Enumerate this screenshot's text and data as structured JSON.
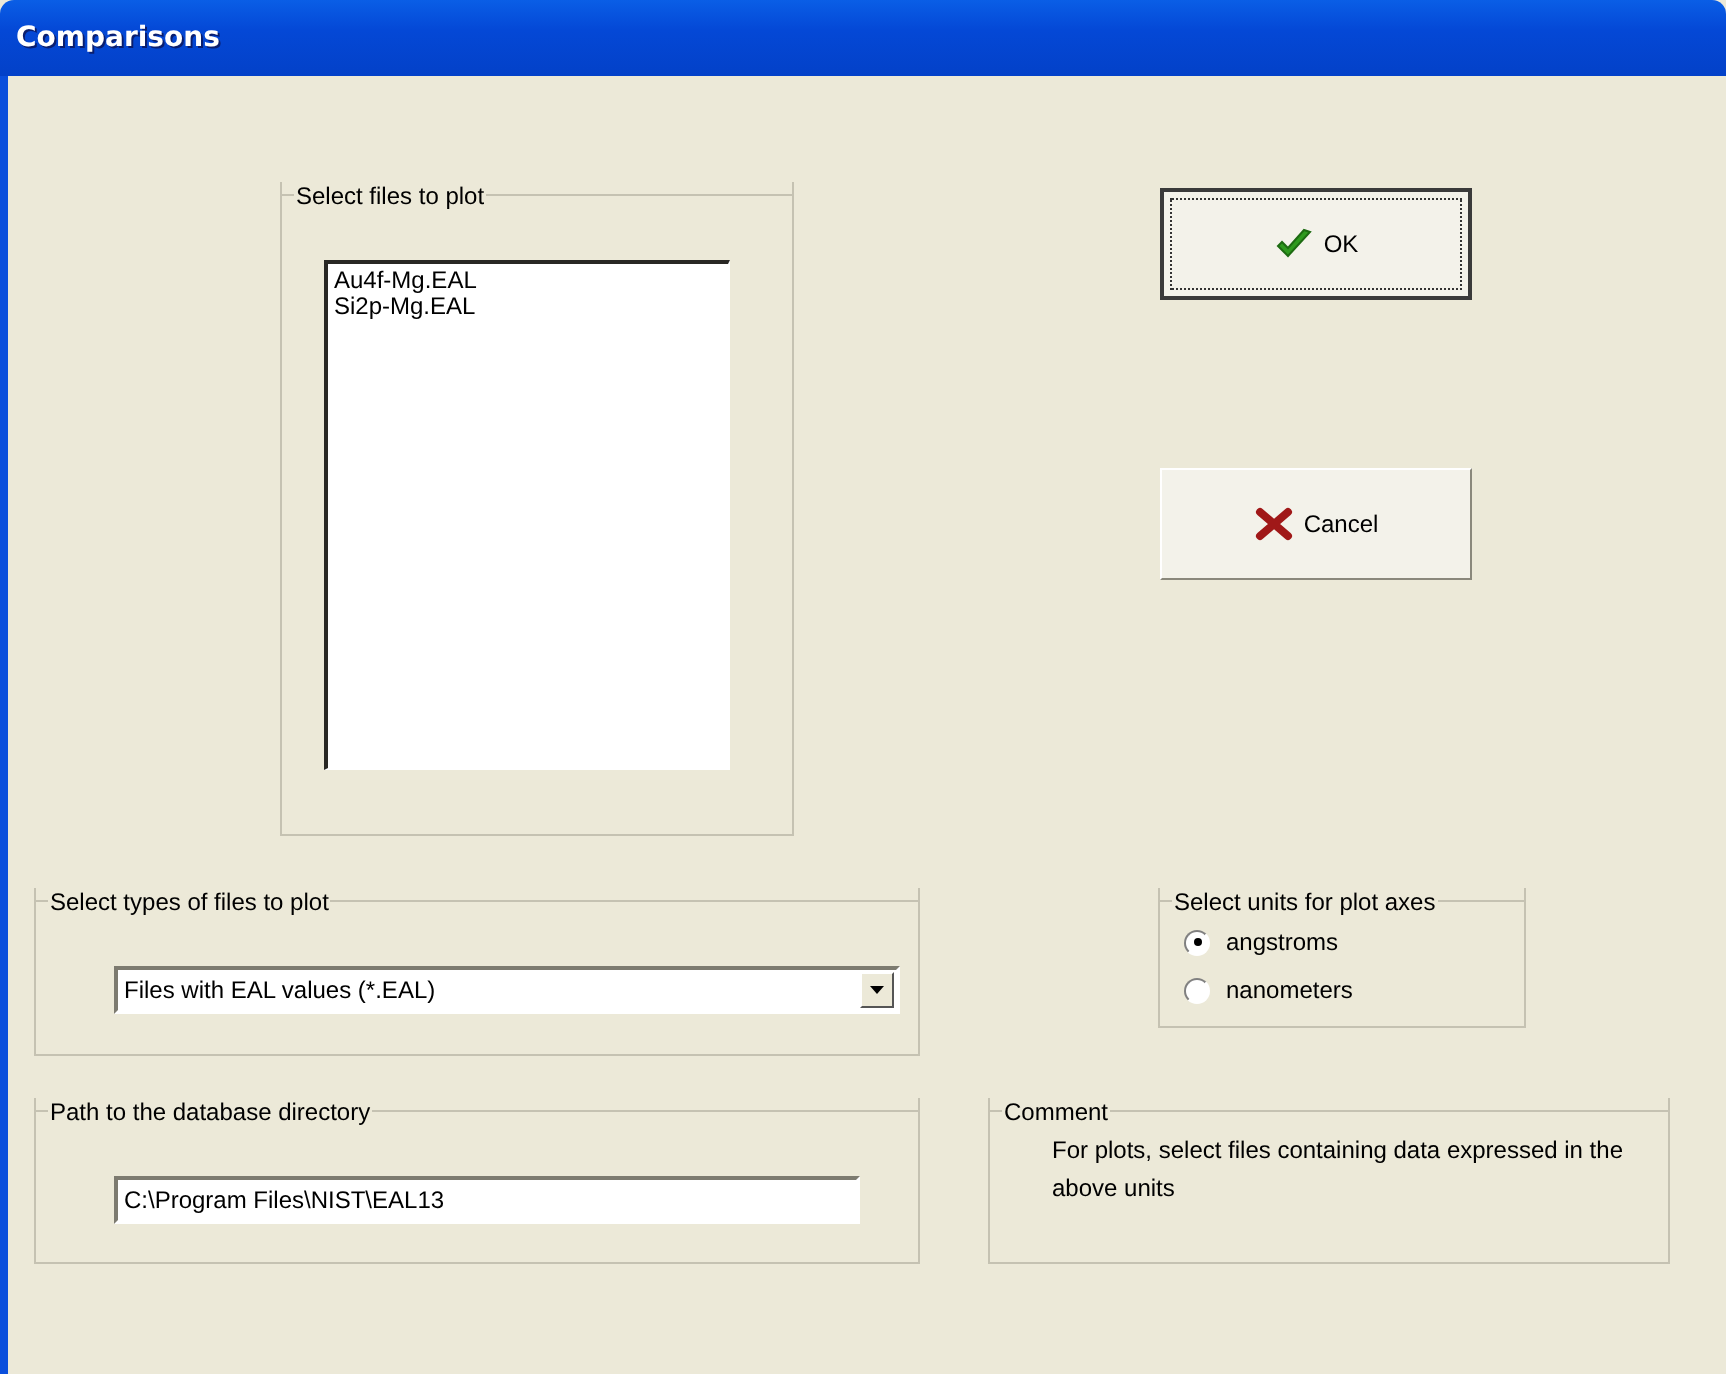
{
  "window": {
    "title": "Comparisons"
  },
  "file_list": {
    "label": "Select files to plot",
    "items": [
      "Au4f-Mg.EAL",
      "Si2p-Mg.EAL"
    ]
  },
  "buttons": [
    {
      "kind": "ok",
      "label": "OK",
      "focused": true
    },
    {
      "kind": "cancel",
      "label": "Cancel",
      "focused": false
    }
  ],
  "file_types": {
    "label": "Select types of files to plot",
    "value": "Files with EAL values (*.EAL)"
  },
  "units": {
    "label": "Select units for plot axes",
    "options": [
      {
        "label": "angstroms",
        "selected": true
      },
      {
        "label": "nanometers",
        "selected": false
      }
    ]
  },
  "database_path": {
    "label": "Path to  the database directory",
    "value": "C:\\Program Files\\NIST\\EAL13"
  },
  "comment": {
    "label": "Comment",
    "text": "For plots, select files containing data expressed in the above units"
  }
}
